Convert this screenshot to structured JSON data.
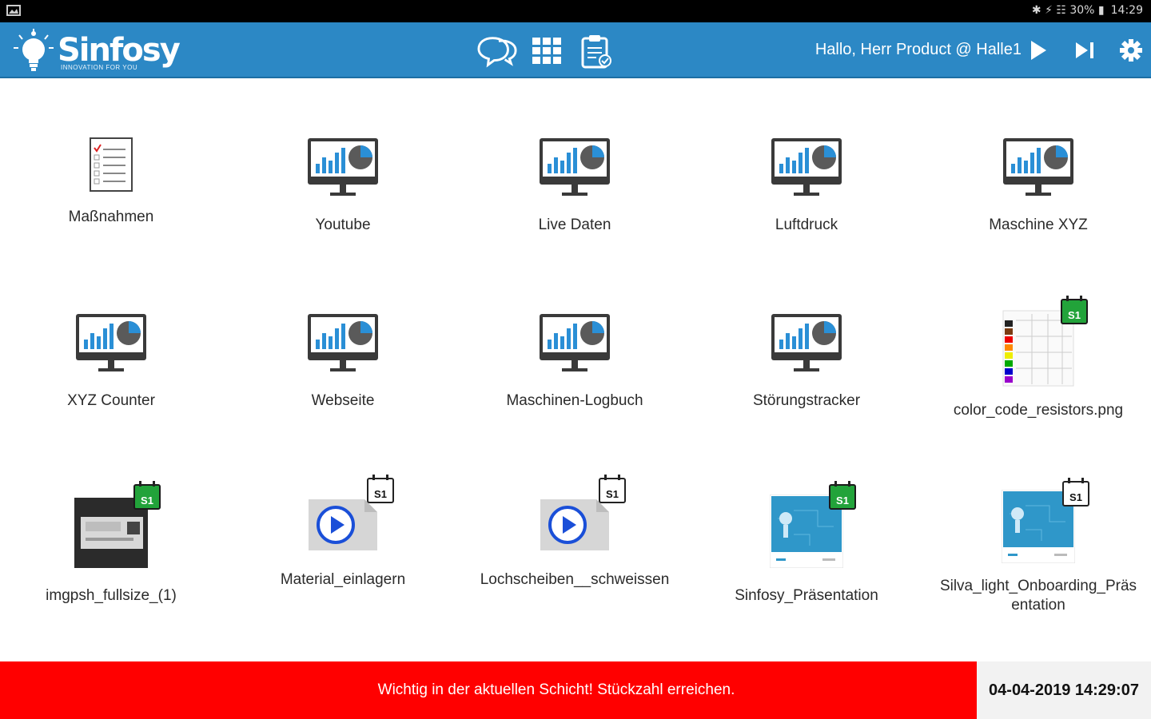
{
  "status_bar": {
    "indicators": "✱ ⚡ ☷ 30% ▮",
    "time": "14:29"
  },
  "header": {
    "logo_name": "Sinfosy",
    "logo_tagline": "INNOVATION FOR YOU",
    "greeting": "Hallo, Herr Product @ Halle1",
    "accent_color": "#2c88c5",
    "icons": [
      "chat-icon",
      "grid-icon",
      "clipboard-icon",
      "play-icon",
      "skip-next-icon",
      "gear-icon"
    ]
  },
  "tiles": [
    {
      "label": "Maßnahmen",
      "icon": "checklist-icon"
    },
    {
      "label": "Youtube",
      "icon": "dashboard-monitor-icon"
    },
    {
      "label": "Live Daten",
      "icon": "dashboard-monitor-icon"
    },
    {
      "label": "Luftdruck",
      "icon": "dashboard-monitor-icon"
    },
    {
      "label": "Maschine XYZ",
      "icon": "dashboard-monitor-icon"
    },
    {
      "label": "XYZ Counter",
      "icon": "dashboard-monitor-icon"
    },
    {
      "label": "Webseite",
      "icon": "dashboard-monitor-icon"
    },
    {
      "label": "Maschinen-Logbuch",
      "icon": "dashboard-monitor-icon"
    },
    {
      "label": "Störungstracker",
      "icon": "dashboard-monitor-icon"
    },
    {
      "label": "color_code_resistors.png",
      "icon": "image-thumbnail-icon",
      "badge": "S1"
    },
    {
      "label": "imgpsh_fullsize_(1)",
      "icon": "photo-thumbnail-icon",
      "badge": "S1"
    },
    {
      "label": "Material_einlagern",
      "icon": "video-file-icon",
      "badge": "S1"
    },
    {
      "label": "Lochscheiben__schweissen",
      "icon": "video-file-icon",
      "badge": "S1"
    },
    {
      "label": "Sinfosy_Präsentation",
      "icon": "presentation-thumbnail-icon",
      "badge": "S1"
    },
    {
      "label": "Silva_light_Onboarding_Präs entation",
      "icon": "presentation-thumbnail-icon",
      "badge": "S1"
    }
  ],
  "footer": {
    "message": "Wichtig in der aktuellen Schicht! Stückzahl erreichen.",
    "datetime": "04-04-2019 14:29:07",
    "message_color": "#ff0000"
  }
}
